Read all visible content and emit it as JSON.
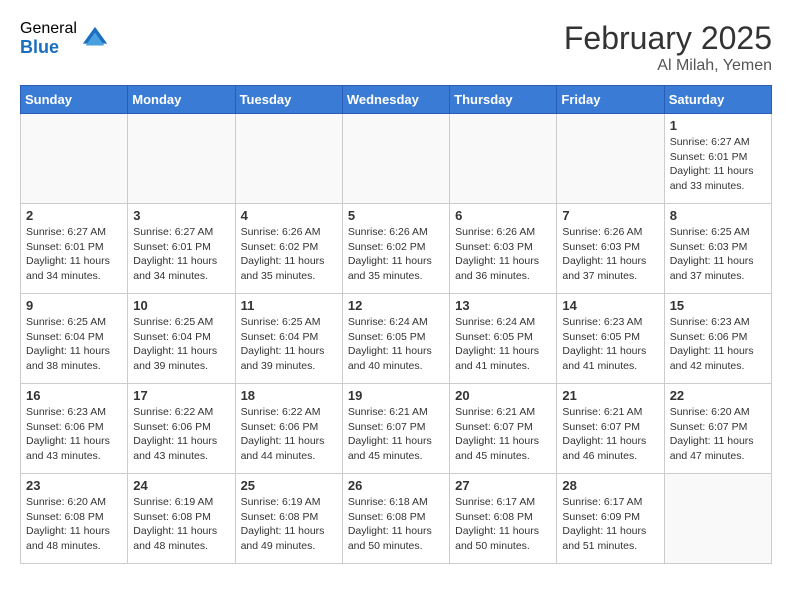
{
  "header": {
    "logo_general": "General",
    "logo_blue": "Blue",
    "month_year": "February 2025",
    "location": "Al Milah, Yemen"
  },
  "weekdays": [
    "Sunday",
    "Monday",
    "Tuesday",
    "Wednesday",
    "Thursday",
    "Friday",
    "Saturday"
  ],
  "weeks": [
    [
      {
        "day": "",
        "info": ""
      },
      {
        "day": "",
        "info": ""
      },
      {
        "day": "",
        "info": ""
      },
      {
        "day": "",
        "info": ""
      },
      {
        "day": "",
        "info": ""
      },
      {
        "day": "",
        "info": ""
      },
      {
        "day": "1",
        "info": "Sunrise: 6:27 AM\nSunset: 6:01 PM\nDaylight: 11 hours\nand 33 minutes."
      }
    ],
    [
      {
        "day": "2",
        "info": "Sunrise: 6:27 AM\nSunset: 6:01 PM\nDaylight: 11 hours\nand 34 minutes."
      },
      {
        "day": "3",
        "info": "Sunrise: 6:27 AM\nSunset: 6:01 PM\nDaylight: 11 hours\nand 34 minutes."
      },
      {
        "day": "4",
        "info": "Sunrise: 6:26 AM\nSunset: 6:02 PM\nDaylight: 11 hours\nand 35 minutes."
      },
      {
        "day": "5",
        "info": "Sunrise: 6:26 AM\nSunset: 6:02 PM\nDaylight: 11 hours\nand 35 minutes."
      },
      {
        "day": "6",
        "info": "Sunrise: 6:26 AM\nSunset: 6:03 PM\nDaylight: 11 hours\nand 36 minutes."
      },
      {
        "day": "7",
        "info": "Sunrise: 6:26 AM\nSunset: 6:03 PM\nDaylight: 11 hours\nand 37 minutes."
      },
      {
        "day": "8",
        "info": "Sunrise: 6:25 AM\nSunset: 6:03 PM\nDaylight: 11 hours\nand 37 minutes."
      }
    ],
    [
      {
        "day": "9",
        "info": "Sunrise: 6:25 AM\nSunset: 6:04 PM\nDaylight: 11 hours\nand 38 minutes."
      },
      {
        "day": "10",
        "info": "Sunrise: 6:25 AM\nSunset: 6:04 PM\nDaylight: 11 hours\nand 39 minutes."
      },
      {
        "day": "11",
        "info": "Sunrise: 6:25 AM\nSunset: 6:04 PM\nDaylight: 11 hours\nand 39 minutes."
      },
      {
        "day": "12",
        "info": "Sunrise: 6:24 AM\nSunset: 6:05 PM\nDaylight: 11 hours\nand 40 minutes."
      },
      {
        "day": "13",
        "info": "Sunrise: 6:24 AM\nSunset: 6:05 PM\nDaylight: 11 hours\nand 41 minutes."
      },
      {
        "day": "14",
        "info": "Sunrise: 6:23 AM\nSunset: 6:05 PM\nDaylight: 11 hours\nand 41 minutes."
      },
      {
        "day": "15",
        "info": "Sunrise: 6:23 AM\nSunset: 6:06 PM\nDaylight: 11 hours\nand 42 minutes."
      }
    ],
    [
      {
        "day": "16",
        "info": "Sunrise: 6:23 AM\nSunset: 6:06 PM\nDaylight: 11 hours\nand 43 minutes."
      },
      {
        "day": "17",
        "info": "Sunrise: 6:22 AM\nSunset: 6:06 PM\nDaylight: 11 hours\nand 43 minutes."
      },
      {
        "day": "18",
        "info": "Sunrise: 6:22 AM\nSunset: 6:06 PM\nDaylight: 11 hours\nand 44 minutes."
      },
      {
        "day": "19",
        "info": "Sunrise: 6:21 AM\nSunset: 6:07 PM\nDaylight: 11 hours\nand 45 minutes."
      },
      {
        "day": "20",
        "info": "Sunrise: 6:21 AM\nSunset: 6:07 PM\nDaylight: 11 hours\nand 45 minutes."
      },
      {
        "day": "21",
        "info": "Sunrise: 6:21 AM\nSunset: 6:07 PM\nDaylight: 11 hours\nand 46 minutes."
      },
      {
        "day": "22",
        "info": "Sunrise: 6:20 AM\nSunset: 6:07 PM\nDaylight: 11 hours\nand 47 minutes."
      }
    ],
    [
      {
        "day": "23",
        "info": "Sunrise: 6:20 AM\nSunset: 6:08 PM\nDaylight: 11 hours\nand 48 minutes."
      },
      {
        "day": "24",
        "info": "Sunrise: 6:19 AM\nSunset: 6:08 PM\nDaylight: 11 hours\nand 48 minutes."
      },
      {
        "day": "25",
        "info": "Sunrise: 6:19 AM\nSunset: 6:08 PM\nDaylight: 11 hours\nand 49 minutes."
      },
      {
        "day": "26",
        "info": "Sunrise: 6:18 AM\nSunset: 6:08 PM\nDaylight: 11 hours\nand 50 minutes."
      },
      {
        "day": "27",
        "info": "Sunrise: 6:17 AM\nSunset: 6:08 PM\nDaylight: 11 hours\nand 50 minutes."
      },
      {
        "day": "28",
        "info": "Sunrise: 6:17 AM\nSunset: 6:09 PM\nDaylight: 11 hours\nand 51 minutes."
      },
      {
        "day": "",
        "info": ""
      }
    ]
  ]
}
